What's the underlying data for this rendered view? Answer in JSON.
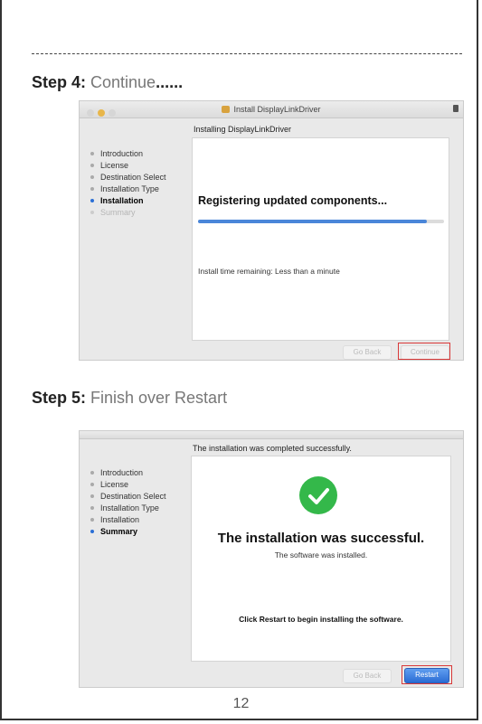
{
  "step4": {
    "label": "Step 4:",
    "text": " Continue",
    "dots": "......"
  },
  "step5": {
    "label": "Step 5:",
    "text": " Finish over Restart"
  },
  "window1": {
    "title": "Install DisplayLinkDriver",
    "heading": "Installing DisplayLinkDriver",
    "sidebar": [
      "Introduction",
      "License",
      "Destination Select",
      "Installation Type",
      "Installation",
      "Summary"
    ],
    "status": "Registering updated components...",
    "progress": 0.93,
    "remaining": "Install time remaining: Less than a minute",
    "back": "Go Back",
    "continue": "Continue"
  },
  "window2": {
    "heading": "The installation was completed successfully.",
    "sidebar": [
      "Introduction",
      "License",
      "Destination Select",
      "Installation Type",
      "Installation",
      "Summary"
    ],
    "success": "The installation was successful.",
    "sub": "The software was installed.",
    "note": "Click Restart to begin installing the software.",
    "back": "Go Back",
    "restart": "Restart"
  },
  "page_number": "12"
}
